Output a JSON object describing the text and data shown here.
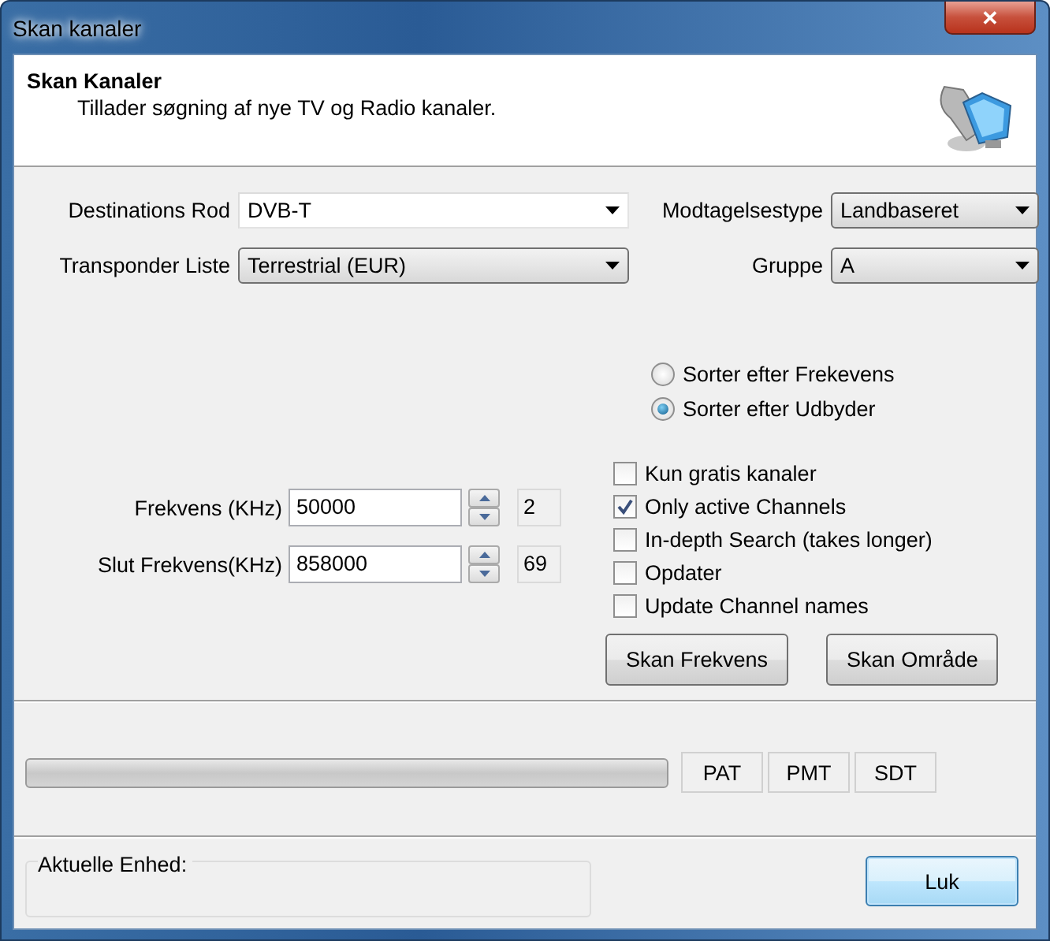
{
  "window": {
    "title": "Skan kanaler",
    "close": "✕"
  },
  "header": {
    "title": "Skan Kanaler",
    "subtitle": "Tillader søgning af nye TV og Radio kanaler."
  },
  "selects": [
    {
      "label": "Destinations Rod",
      "value": "DVB-T",
      "editable": true
    },
    {
      "label": "Modtagelsestype",
      "value": "Landbaseret",
      "editable": false
    },
    {
      "label": "Transponder Liste",
      "value": "Terrestrial (EUR)",
      "editable": false
    },
    {
      "label": "Gruppe",
      "value": "A",
      "editable": false
    }
  ],
  "sort_options": [
    {
      "label": "Sorter efter Frekevens",
      "selected": false
    },
    {
      "label": "Sorter efter Udbyder",
      "selected": true
    }
  ],
  "frequency_fields": [
    {
      "label": "Frekvens (KHz)",
      "value": "50000",
      "channel": "2"
    },
    {
      "label": "Slut Frekvens(KHz)",
      "value": "858000",
      "channel": "69"
    }
  ],
  "options": [
    {
      "label": "Kun gratis kanaler",
      "checked": false
    },
    {
      "label": "Only active Channels",
      "checked": true
    },
    {
      "label": "In-depth Search (takes longer)",
      "checked": false
    },
    {
      "label": "Opdater",
      "checked": false
    },
    {
      "label": "Update Channel names",
      "checked": false
    }
  ],
  "scan_buttons": [
    "Skan Frekvens",
    "Skan Område"
  ],
  "progress": {
    "level": 0
  },
  "table_buttons": [
    "PAT",
    "PMT",
    "SDT"
  ],
  "current_device": {
    "label": "Aktuelle Enhed:"
  },
  "close_button": "Luk"
}
